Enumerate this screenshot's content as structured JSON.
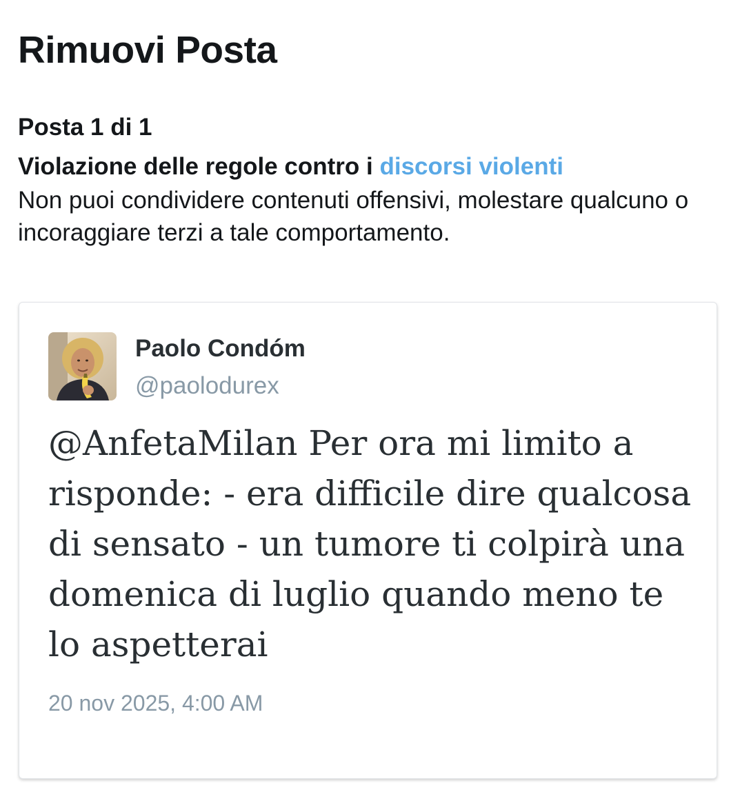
{
  "header": {
    "title": "Rimuovi Posta"
  },
  "violation": {
    "counter": "Posta 1 di 1",
    "title_prefix": "Violazione delle regole contro i ",
    "link_text": "discorsi violenti",
    "description": "Non puoi condividere contenuti offensivi, molestare qualcuno o incoraggiare terzi a tale comportamento."
  },
  "tweet": {
    "author_name": "Paolo Condóm",
    "author_handle": "@paolodurex",
    "avatar_icon": "profile-photo",
    "text": "@AnfetaMilan Per ora mi limito a risponde: - era difficile dire qualcosa di sensato - un tumore ti colpirà una domenica di luglio quando meno te lo aspetterai",
    "timestamp": "20 nov 2025, 4:00 AM"
  },
  "colors": {
    "link": "#5aa9e6",
    "text_primary": "#14171a",
    "text_secondary": "#8899a6"
  }
}
